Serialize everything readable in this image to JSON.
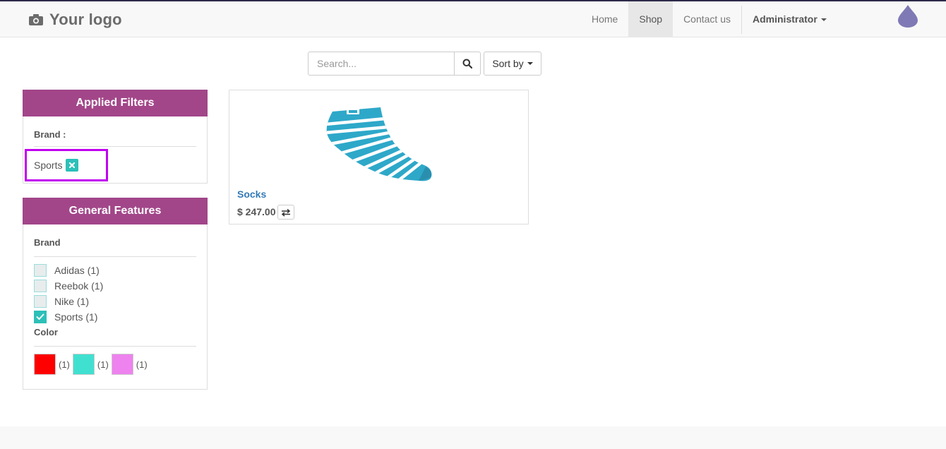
{
  "header": {
    "logo_text": "Your logo",
    "nav": [
      {
        "label": "Home"
      },
      {
        "label": "Shop",
        "active": true
      },
      {
        "label": "Contact us"
      }
    ],
    "user": "Administrator"
  },
  "search": {
    "placeholder": "Search...",
    "value": "",
    "sort_label": "Sort by"
  },
  "applied_filters": {
    "title": "Applied Filters",
    "group_label": "Brand :",
    "tag": "Sports"
  },
  "general_features": {
    "title": "General Features",
    "brand_label": "Brand",
    "brands": [
      {
        "label": "Adidas (1)",
        "checked": false
      },
      {
        "label": "Reebok (1)",
        "checked": false
      },
      {
        "label": "Nike (1)",
        "checked": false
      },
      {
        "label": "Sports (1)",
        "checked": true
      }
    ],
    "color_label": "Color",
    "colors": [
      {
        "hex": "#ff0000",
        "count": "(1)"
      },
      {
        "hex": "#40e0d0",
        "count": "(1)"
      },
      {
        "hex": "#ee82ee",
        "count": "(1)"
      }
    ]
  },
  "product": {
    "name": "Socks",
    "price": "$ 247.00"
  },
  "colors": {
    "accent": "#a24689",
    "link": "#337ab7",
    "teal": "#2cc0b8",
    "highlight": "#c100f0"
  }
}
